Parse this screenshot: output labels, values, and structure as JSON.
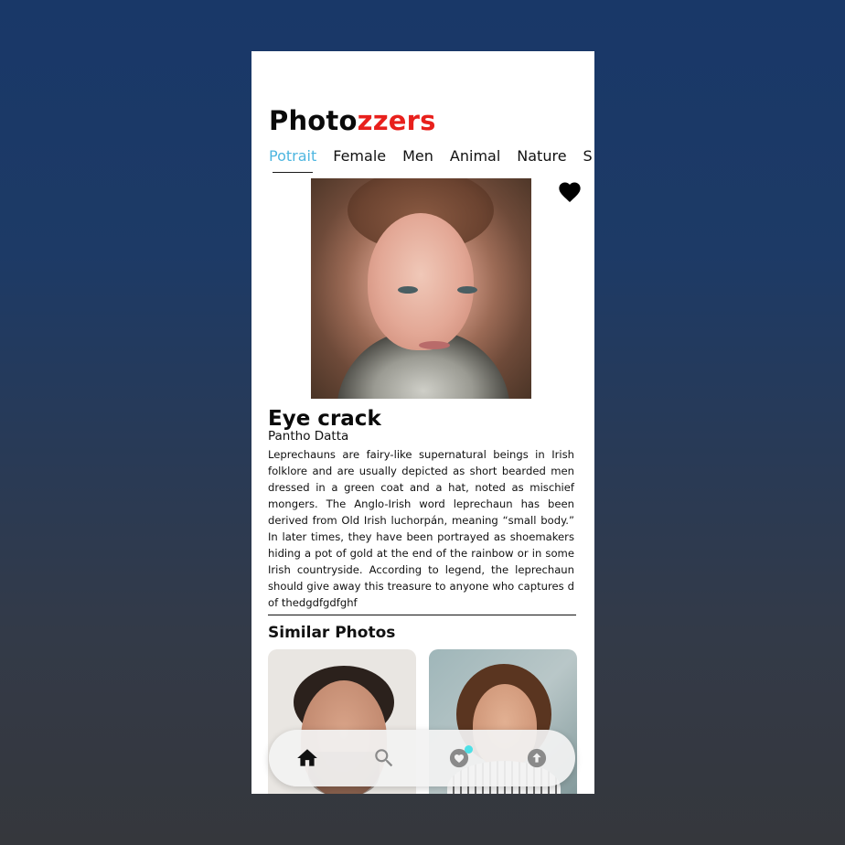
{
  "app": {
    "logo_part1": "Photo",
    "logo_part2": "zzers",
    "accent": "#e8201c",
    "tab_active_color": "#4db6e0"
  },
  "tabs": [
    {
      "label": "Potrait",
      "active": true
    },
    {
      "label": "Female",
      "active": false
    },
    {
      "label": "Men",
      "active": false
    },
    {
      "label": "Animal",
      "active": false
    },
    {
      "label": "Nature",
      "active": false
    },
    {
      "label": "S",
      "active": false
    }
  ],
  "photo": {
    "title": "Eye crack",
    "author": "Pantho Datta",
    "description": "Leprechauns are fairy-like supernatural beings in Irish folklore and are usually depicted as short bearded men dressed in a green coat and a hat, noted as mischief mongers. The Anglo-Irish word leprechaun has been derived from Old Irish luchorpán, meaning “small body.” In later times, they have been portrayed as shoemakers hiding a pot of gold at the end of the rainbow or in some Irish countryside. According to legend, the leprechaun should give away this treasure to anyone who captures d of thedgdfgdfghf",
    "favorite_icon": "heart-icon"
  },
  "similar": {
    "title": "Similar Photos",
    "items": [
      "man-portrait",
      "woman-portrait"
    ]
  },
  "navbar": {
    "items": [
      "home-icon",
      "search-icon",
      "favorites-icon",
      "upload-icon"
    ],
    "badge_color": "#4ee0e6"
  }
}
